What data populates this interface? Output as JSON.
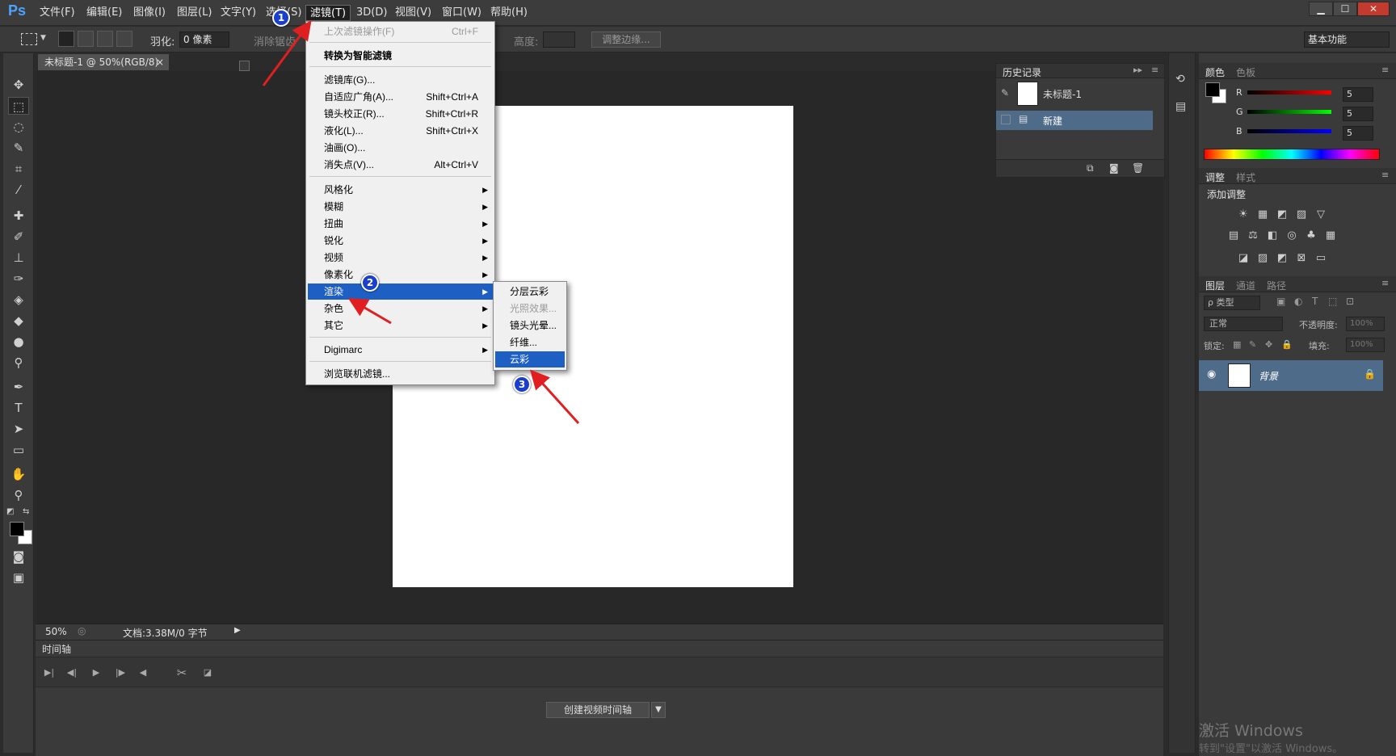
{
  "app": {
    "logo": "Ps"
  },
  "menubar": {
    "items": [
      "文件(F)",
      "编辑(E)",
      "图像(I)",
      "图层(L)",
      "文字(Y)",
      "选择(S)",
      "滤镜(T)",
      "3D(D)",
      "视图(V)",
      "窗口(W)",
      "帮助(H)"
    ],
    "window_buttons": [
      "▁",
      "☐",
      "✕"
    ]
  },
  "options": {
    "feather_label": "羽化:",
    "feather_value": "0 像素",
    "antialias_label": "消除锯齿",
    "height_label": "高度:",
    "refine_edge_label": "调整边缘...",
    "workspace": "基本功能"
  },
  "document": {
    "tab_title": "未标题-1 @ 50%(RGB/8)",
    "tab_close": "×",
    "zoom": "50%",
    "doc_info": "文档:3.38M/0 字节"
  },
  "timeline": {
    "tab": "时间轴",
    "create_button": "创建视频时间轴",
    "dropdown_arrow": "▼"
  },
  "history": {
    "tab": "历史记录",
    "items": [
      {
        "label": "未标题-1",
        "selected": false
      },
      {
        "label": "新建",
        "selected": true
      }
    ]
  },
  "color_panel": {
    "tabs": [
      "颜色",
      "色板"
    ],
    "channels": [
      {
        "name": "R",
        "value": "5",
        "color": "#d42020"
      },
      {
        "name": "G",
        "value": "5",
        "color": "#20b020"
      },
      {
        "name": "B",
        "value": "5",
        "color": "#2040d4"
      }
    ]
  },
  "adjustments_panel": {
    "tabs": [
      "调整",
      "样式"
    ],
    "title": "添加调整",
    "icons_row1": [
      "☀",
      "▦",
      "◩",
      "▨",
      "▽"
    ],
    "icons_row2": [
      "▤",
      "⚖",
      "◧",
      "◎",
      "♣",
      "▦"
    ],
    "icons_row3": [
      "◪",
      "▨",
      "◩",
      "⊠",
      "▭"
    ]
  },
  "layers_panel": {
    "tabs": [
      "图层",
      "通道",
      "路径"
    ],
    "kind_filter": "ρ 类型",
    "blend_mode": "正常",
    "opacity_label": "不透明度:",
    "opacity_value": "100%",
    "lock_label": "锁定:",
    "fill_label": "填充:",
    "fill_value": "100%",
    "layers": [
      {
        "name": "背景",
        "locked": true,
        "visible": true
      }
    ]
  },
  "filter_menu": {
    "items": [
      {
        "label": "上次滤镜操作(F)",
        "shortcut": "Ctrl+F",
        "disabled": true
      },
      {
        "sep": true
      },
      {
        "label": "转换为智能滤镜",
        "bold": true
      },
      {
        "sep": true
      },
      {
        "label": "滤镜库(G)...",
        "shortcut": ""
      },
      {
        "label": "自适应广角(A)...",
        "shortcut": "Shift+Ctrl+A"
      },
      {
        "label": "镜头校正(R)...",
        "shortcut": "Shift+Ctrl+R"
      },
      {
        "label": "液化(L)...",
        "shortcut": "Shift+Ctrl+X"
      },
      {
        "label": "油画(O)...",
        "shortcut": ""
      },
      {
        "label": "消失点(V)...",
        "shortcut": "Alt+Ctrl+V"
      },
      {
        "sep": true
      },
      {
        "label": "风格化",
        "submenu": true
      },
      {
        "label": "模糊",
        "submenu": true
      },
      {
        "label": "扭曲",
        "submenu": true
      },
      {
        "label": "锐化",
        "submenu": true
      },
      {
        "label": "视频",
        "submenu": true
      },
      {
        "label": "像素化",
        "submenu": true
      },
      {
        "label": "渲染",
        "submenu": true,
        "highlighted": true
      },
      {
        "label": "杂色",
        "submenu": true
      },
      {
        "label": "其它",
        "submenu": true
      },
      {
        "sep": true
      },
      {
        "label": "Digimarc",
        "submenu": true
      },
      {
        "sep": true
      },
      {
        "label": "浏览联机滤镜..."
      }
    ]
  },
  "render_submenu": {
    "items": [
      {
        "label": "分层云彩"
      },
      {
        "label": "光照效果...",
        "disabled": true
      },
      {
        "label": "镜头光晕..."
      },
      {
        "label": "纤维..."
      },
      {
        "label": "云彩",
        "highlighted": true
      }
    ]
  },
  "annotations": [
    "1",
    "2",
    "3"
  ],
  "watermark": {
    "line1": "激活 Windows",
    "line2": "转到\"设置\"以激活 Windows。"
  }
}
